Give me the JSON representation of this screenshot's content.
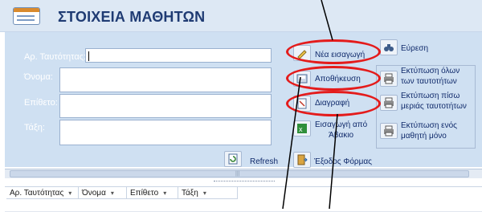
{
  "form": {
    "title": "ΣΤΟΙΧΕΙΑ ΜΑΘΗΤΩΝ"
  },
  "fields": {
    "id_label": "Αρ. Ταυτότητας:",
    "name_label": "Όνομα:",
    "surname_label": "Επίθετο:",
    "class_label": "Τάξη:",
    "id_value": "",
    "name_value": "",
    "surname_value": "",
    "class_value": ""
  },
  "buttons": {
    "new_record": "Νέα εισαγωγή",
    "save": "Αποθήκευση",
    "delete": "Διαγραφή",
    "import_1": "Εισαγωγή από",
    "import_2": "Άβακιο",
    "exit": "Έξοδος Φόρμας",
    "refresh": "Refresh",
    "find": "Εύρεση",
    "print_all_1": "Εκτύπωση όλων",
    "print_all_2": "των ταυτοτήτων",
    "print_back_1": "Εκτύπωση πίσω",
    "print_back_2": "μεριάς ταυτοτήτων",
    "print_one_1": "Εκτύπωση ενός",
    "print_one_2": "μαθητή μόνο"
  },
  "datasheet": {
    "columns": [
      "Αρ. Ταυτότητας",
      "Όνομα",
      "Επίθετο",
      "Τάξη"
    ]
  },
  "colors": {
    "highlight_ring": "#e41b1b",
    "header_bg": "#dde8f4",
    "body_bg": "#cfe0f2",
    "title": "#1f3b73"
  }
}
